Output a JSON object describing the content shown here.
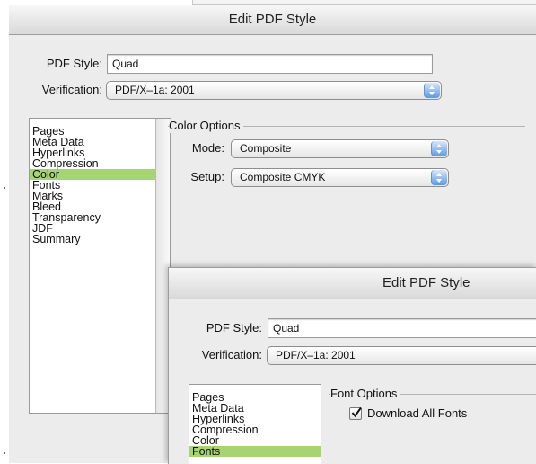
{
  "back_window": {
    "title": "Edit PDF Style",
    "pdf_style_label": "PDF Style:",
    "pdf_style_value": "Quad",
    "verification_label": "Verification:",
    "verification_value": "PDF/X–1a: 2001",
    "categories": [
      {
        "label": "Pages",
        "selected": false
      },
      {
        "label": "Meta Data",
        "selected": false
      },
      {
        "label": "Hyperlinks",
        "selected": false
      },
      {
        "label": "Compression",
        "selected": false
      },
      {
        "label": "Color",
        "selected": true
      },
      {
        "label": "Fonts",
        "selected": false
      },
      {
        "label": "Marks",
        "selected": false
      },
      {
        "label": "Bleed",
        "selected": false
      },
      {
        "label": "Transparency",
        "selected": false
      },
      {
        "label": "JDF",
        "selected": false
      },
      {
        "label": "Summary",
        "selected": false
      }
    ],
    "group_title": "Color Options",
    "mode_label": "Mode:",
    "mode_value": "Composite",
    "setup_label": "Setup:",
    "setup_value": "Composite CMYK"
  },
  "front_window": {
    "title": "Edit PDF Style",
    "pdf_style_label": "PDF Style:",
    "pdf_style_value": "Quad",
    "verification_label": "Verification:",
    "verification_value": "PDF/X–1a: 2001",
    "categories": [
      {
        "label": "Pages",
        "selected": false
      },
      {
        "label": "Meta Data",
        "selected": false
      },
      {
        "label": "Hyperlinks",
        "selected": false
      },
      {
        "label": "Compression",
        "selected": false
      },
      {
        "label": "Color",
        "selected": false
      },
      {
        "label": "Fonts",
        "selected": true
      }
    ],
    "group_title": "Font Options",
    "download_fonts_label": "Download All Fonts",
    "download_fonts_checked": true
  },
  "colors": {
    "selection": "#a6d472",
    "popup_arrow": "#5c97e4",
    "window_bg": "#ececec"
  }
}
